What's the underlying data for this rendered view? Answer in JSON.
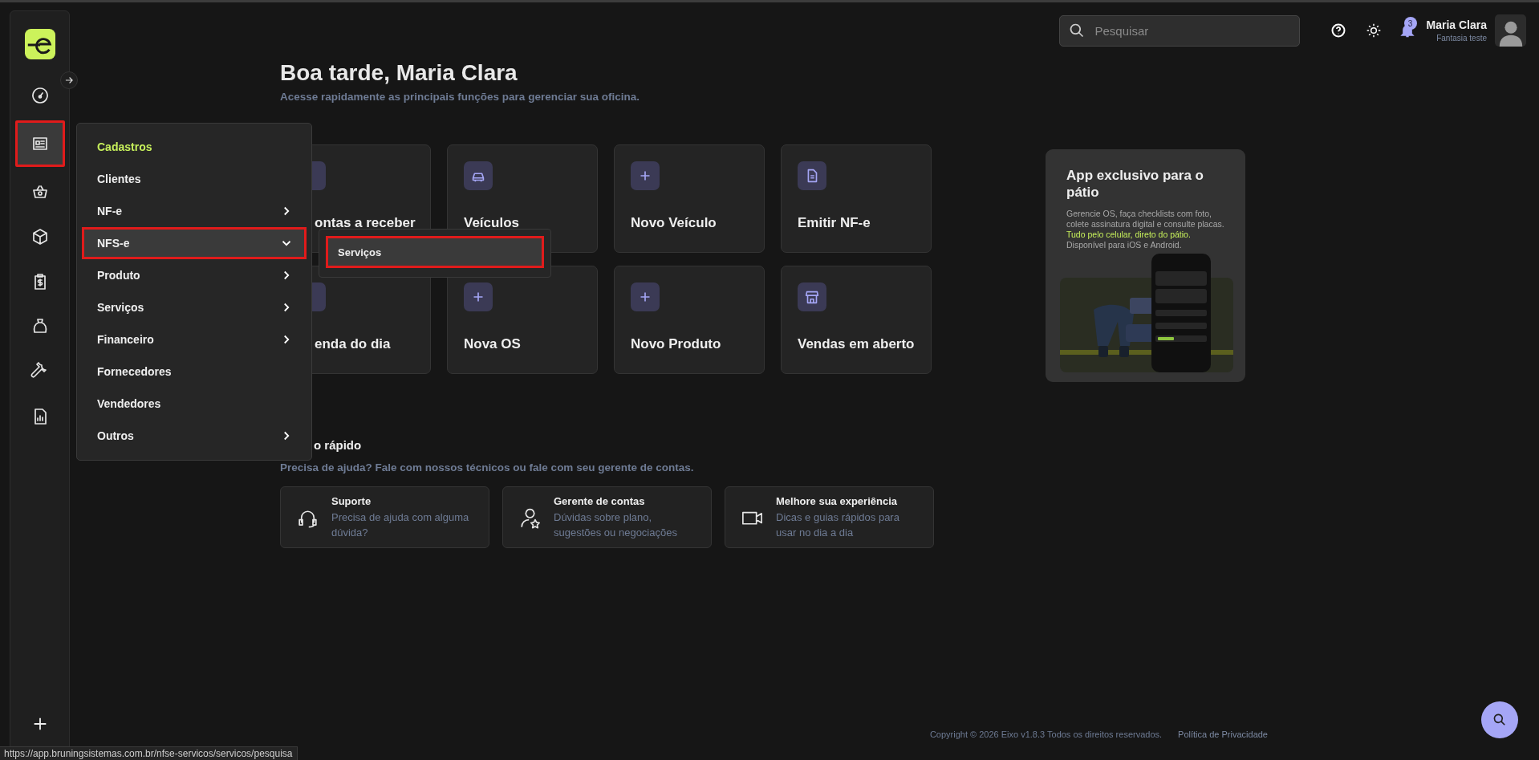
{
  "sidebar": {
    "items": [
      {
        "selected": false
      },
      {
        "selected": true
      },
      {
        "selected": false
      },
      {
        "selected": false
      },
      {
        "selected": false
      },
      {
        "selected": false
      },
      {
        "selected": false
      },
      {
        "selected": false
      }
    ]
  },
  "header": {
    "search": {
      "placeholder": "Pesquisar"
    },
    "notifications": {
      "count": "3"
    },
    "user": {
      "name": "Maria Clara",
      "company": "Fantasia teste"
    }
  },
  "greeting": {
    "title": "Boa tarde, Maria Clara",
    "subtitle": "Acesse rapidamente as principais funções para gerenciar sua oficina."
  },
  "shortcuts": [
    {
      "title": "ontas a receber",
      "partly_hidden": true
    },
    {
      "title": "Veículos",
      "partly_hidden": false
    },
    {
      "title": "Novo Veículo",
      "partly_hidden": false
    },
    {
      "title": "Emitir NF-e",
      "partly_hidden": false
    },
    {
      "title": "enda do dia",
      "partly_hidden": true
    },
    {
      "title": "Nova OS",
      "partly_hidden": false
    },
    {
      "title": "Novo Produto",
      "partly_hidden": false
    },
    {
      "title": "Vendas em aberto",
      "partly_hidden": false
    }
  ],
  "promo": {
    "title": "App exclusivo para o pátio",
    "text": [
      {
        "text": "Gerencie OS, faça checklists com foto, colete assinatura digital e consulte placas. ",
        "highlight": false
      },
      {
        "text": "Tudo pelo celular, direto do pátio.",
        "highlight": true
      },
      {
        "text": " Disponível para iOS e Android.",
        "highlight": false
      }
    ]
  },
  "help": {
    "title": "o rápido",
    "subtitle": "Precisa de ajuda? Fale com nossos técnicos ou fale com seu gerente de contas.",
    "cards": [
      {
        "title": "Suporte",
        "text": "Precisa de ajuda com alguma dúvida?"
      },
      {
        "title": "Gerente de contas",
        "text": "Dúvidas sobre plano, sugestões ou negociações"
      },
      {
        "title": "Melhore sua experiência",
        "text": "Dicas e guias rápidos para usar no dia a dia"
      }
    ]
  },
  "footer": {
    "copyright": "Copyright © 2026 Eixo v1.8.3 Todos os direitos reservados.",
    "privacy_link": "Política de Privacidade"
  },
  "menu": {
    "items": [
      {
        "label": "Cadastros",
        "kind": "header",
        "has_submenu": false,
        "expanded": false,
        "highlighted": false
      },
      {
        "label": "Clientes",
        "kind": "link",
        "has_submenu": false,
        "expanded": false,
        "highlighted": false
      },
      {
        "label": "NF-e",
        "kind": "link",
        "has_submenu": true,
        "expanded": false,
        "highlighted": false
      },
      {
        "label": "NFS-e",
        "kind": "link",
        "has_submenu": true,
        "expanded": true,
        "highlighted": true
      },
      {
        "label": "Produto",
        "kind": "link",
        "has_submenu": true,
        "expanded": false,
        "highlighted": false
      },
      {
        "label": "Serviços",
        "kind": "link",
        "has_submenu": true,
        "expanded": false,
        "highlighted": false
      },
      {
        "label": "Financeiro",
        "kind": "link",
        "has_submenu": true,
        "expanded": false,
        "highlighted": false
      },
      {
        "label": "Fornecedores",
        "kind": "link",
        "has_submenu": false,
        "expanded": false,
        "highlighted": false
      },
      {
        "label": "Vendedores",
        "kind": "link",
        "has_submenu": false,
        "expanded": false,
        "highlighted": false
      },
      {
        "label": "Outros",
        "kind": "link",
        "has_submenu": true,
        "expanded": false,
        "highlighted": false
      }
    ]
  },
  "submenu": {
    "items": [
      {
        "label": "Serviços",
        "selected": true,
        "highlighted": true
      }
    ]
  },
  "status_bar": {
    "url": "https://app.bruningsistemas.com.br/nfse-servicos/servicos/pesquisa"
  }
}
